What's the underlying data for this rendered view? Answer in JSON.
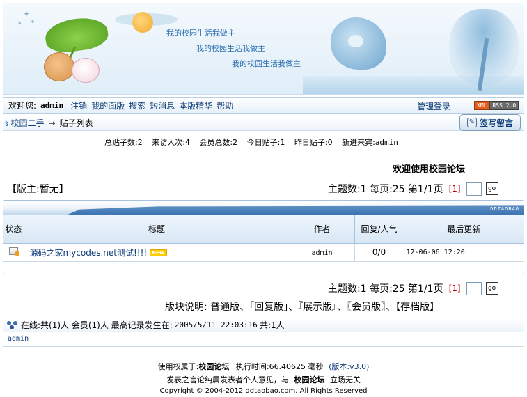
{
  "banner": {
    "slogans": [
      "我的校园生活我做主",
      "我的校园生活我做主",
      "我的校园生活我做主"
    ]
  },
  "nav": {
    "welcome": "欢迎您:",
    "username": "admin",
    "links": [
      "注销",
      "我的面版",
      "搜索",
      "短消息",
      "本版精华",
      "帮助"
    ],
    "admin_login": "管理登录",
    "xml_badge": "XML",
    "rss_badge": "RSS 2.0"
  },
  "breadcrumb": {
    "symbol": "§",
    "board": "校园二手",
    "arrow": "→",
    "page": "贴子列表"
  },
  "post_button": "签写留言",
  "stats": {
    "total_posts": "总贴子数:2",
    "visitors": "来访人次:4",
    "members": "会员总数:2",
    "today_posts": "今日贴子:1",
    "yesterday_posts": "昨日贴子:0",
    "newest_member_label": "新进来宾:",
    "newest_member": "admin"
  },
  "forum_welcome": "欢迎使用校园论坛",
  "moderator": "【版主:暂无】",
  "pager": {
    "summary": "主题数:1 每页:25 第1/1页",
    "page_box": "[1]",
    "go_label": "go"
  },
  "table": {
    "brand": "DDTAOBAO",
    "headers": {
      "status": "状态",
      "title": "标题",
      "author": "作者",
      "reply": "回复/人气",
      "last": "最后更新"
    },
    "rows": [
      {
        "title": "源码之家mycodes.net测试!!!!",
        "badge": "NEW",
        "author": "admin",
        "reply": "0/0",
        "last": "12-06-06 12:20"
      }
    ]
  },
  "legend": "版块说明: 普通版、「回复版」、『展示版』、〖会员版〗、【存档版】",
  "online": {
    "summary_a": "在线:共(1)人 会员(1)人 最高记录发生在:",
    "record_time": "2005/5/11 22:03:16",
    "summary_b": "共:1人",
    "users": "admin"
  },
  "footer": {
    "rights_label": "使用权属于:",
    "forum_name": "校园论坛",
    "exec_time": "执行时间:66.40625 毫秒",
    "version": "(版本:v3.0)",
    "disclaimer_a": "发表之言论纯属发表者个人意见，与",
    "forum_name2": "校园论坛",
    "disclaimer_b": "立场无关",
    "copyright": "Copyright © 2004-2012 ddtaobao.com. All Rights Reserved"
  }
}
